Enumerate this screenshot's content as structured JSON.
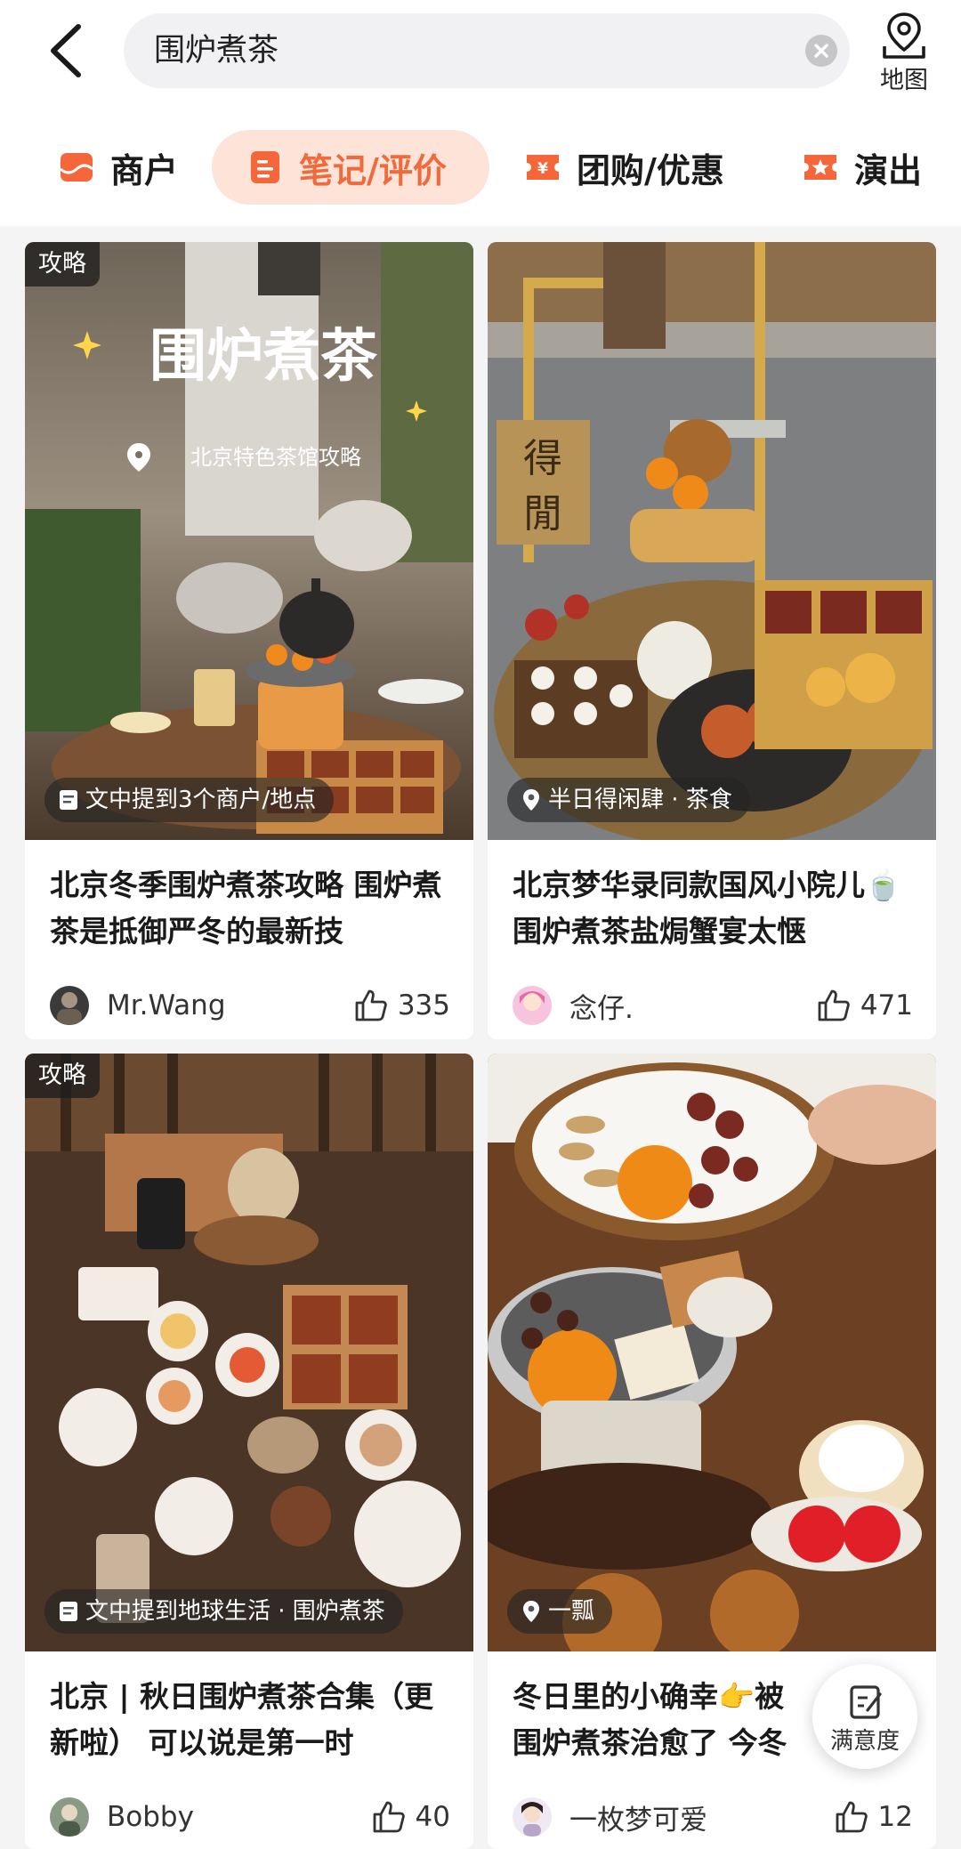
{
  "search": {
    "query": "围炉煮茶",
    "map_label": "地图"
  },
  "tabs": [
    {
      "label": "商户",
      "icon": "shop-icon",
      "active": false
    },
    {
      "label": "笔记/评价",
      "icon": "note-icon",
      "active": true
    },
    {
      "label": "团购/优惠",
      "icon": "coupon-icon",
      "active": false
    },
    {
      "label": "演出",
      "icon": "show-icon",
      "active": false
    }
  ],
  "colors": {
    "accent": "#f06b3c",
    "accent_bg": "#fde3d8",
    "tab_icon": "#f5673a"
  },
  "cards": [
    {
      "badge": "攻略",
      "overlay_title": "围炉煮茶",
      "overlay_subtitle": "北京特色茶馆攻略",
      "pill": "文中提到3个商户/地点",
      "pill_icon": "document-icon",
      "title": "北京冬季围炉煮茶攻略 围炉煮茶是抵御严冬的最新技",
      "author": "Mr.Wang",
      "likes": "335"
    },
    {
      "badge": "",
      "pill": "半日得闲肆 · 茶食",
      "pill_icon": "location-icon",
      "title": "北京梦华录同款国风小院儿🍵围炉煮茶盐焗蟹宴太惬",
      "author": "念仔.",
      "likes": "471"
    },
    {
      "badge": "攻略",
      "pill": "文中提到地球生活 · 围炉煮茶",
      "pill_icon": "document-icon",
      "title": "北京 | 秋日围炉煮茶合集（更新啦） 可以说是第一时",
      "author": "Bobby",
      "likes": "40"
    },
    {
      "badge": "",
      "pill": "一瓢",
      "pill_icon": "location-icon",
      "title": "冬日里的小确幸👉被围炉煮茶治愈了 今冬",
      "author": "一枚梦可爱",
      "likes": "12"
    }
  ],
  "satisfaction": {
    "label": "满意度"
  }
}
